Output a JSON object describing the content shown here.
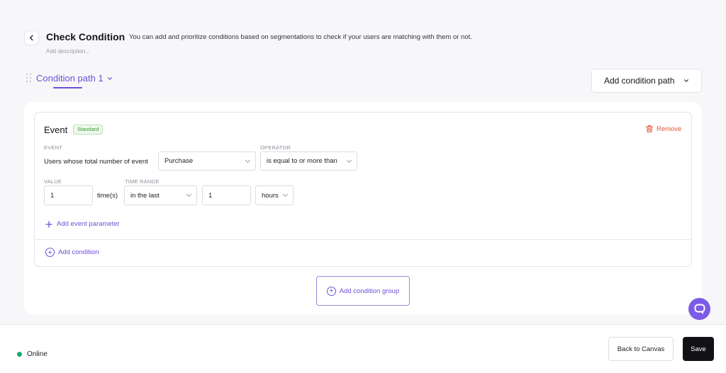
{
  "header": {
    "title": "Check Condition",
    "description": "You can add and prioritize conditions based on segmentations to check if your users are matching with them or not.",
    "add_description_placeholder": "Add description..."
  },
  "path_tabs": {
    "active_label": "Condition path 1",
    "add_path_label": "Add condition path"
  },
  "condition": {
    "title": "Event",
    "badge": "Standard",
    "remove_label": "Remove",
    "event_label": "EVENT",
    "operator_label": "OPERATOR",
    "event_text": "Users whose total number of event",
    "event_select": "Purchase",
    "operator_select": "is equal to or more than",
    "value_label": "VALUE",
    "time_range_label": "TIME RANGE",
    "value_input": "1",
    "times_text": "time(s)",
    "time_range_select": "in the last",
    "time_amount_input": "1",
    "time_unit_select": "hours",
    "add_param_label": "Add event parameter",
    "add_condition_label": "Add condition"
  },
  "add_group_label": "Add condition group",
  "footer": {
    "status": "Online",
    "back_label": "Back to Canvas",
    "save_label": "Save"
  },
  "colors": {
    "accent": "#6f4fd6",
    "remove": "#e0552c",
    "online": "#1aaa6d",
    "badge_green": "#3c9a34"
  }
}
